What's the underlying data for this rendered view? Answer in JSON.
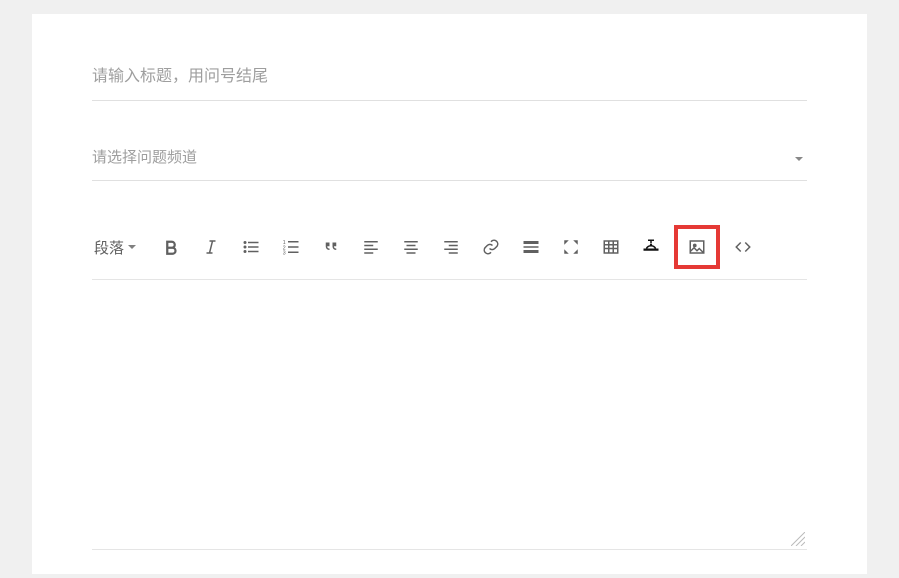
{
  "title_input": {
    "placeholder": "请输入标题，用问号结尾",
    "value": ""
  },
  "channel_select": {
    "placeholder": "请选择问题频道"
  },
  "toolbar": {
    "format_label": "段落",
    "buttons": [
      {
        "name": "bold-icon"
      },
      {
        "name": "italic-icon"
      },
      {
        "name": "unordered-list-icon"
      },
      {
        "name": "ordered-list-icon"
      },
      {
        "name": "blockquote-icon"
      },
      {
        "name": "align-left-icon"
      },
      {
        "name": "align-center-icon"
      },
      {
        "name": "align-right-icon"
      },
      {
        "name": "link-icon"
      },
      {
        "name": "horizontal-rule-icon"
      },
      {
        "name": "fullscreen-icon"
      },
      {
        "name": "table-icon"
      },
      {
        "name": "hide-icon"
      },
      {
        "name": "image-icon",
        "highlight": true
      },
      {
        "name": "code-icon"
      }
    ]
  }
}
